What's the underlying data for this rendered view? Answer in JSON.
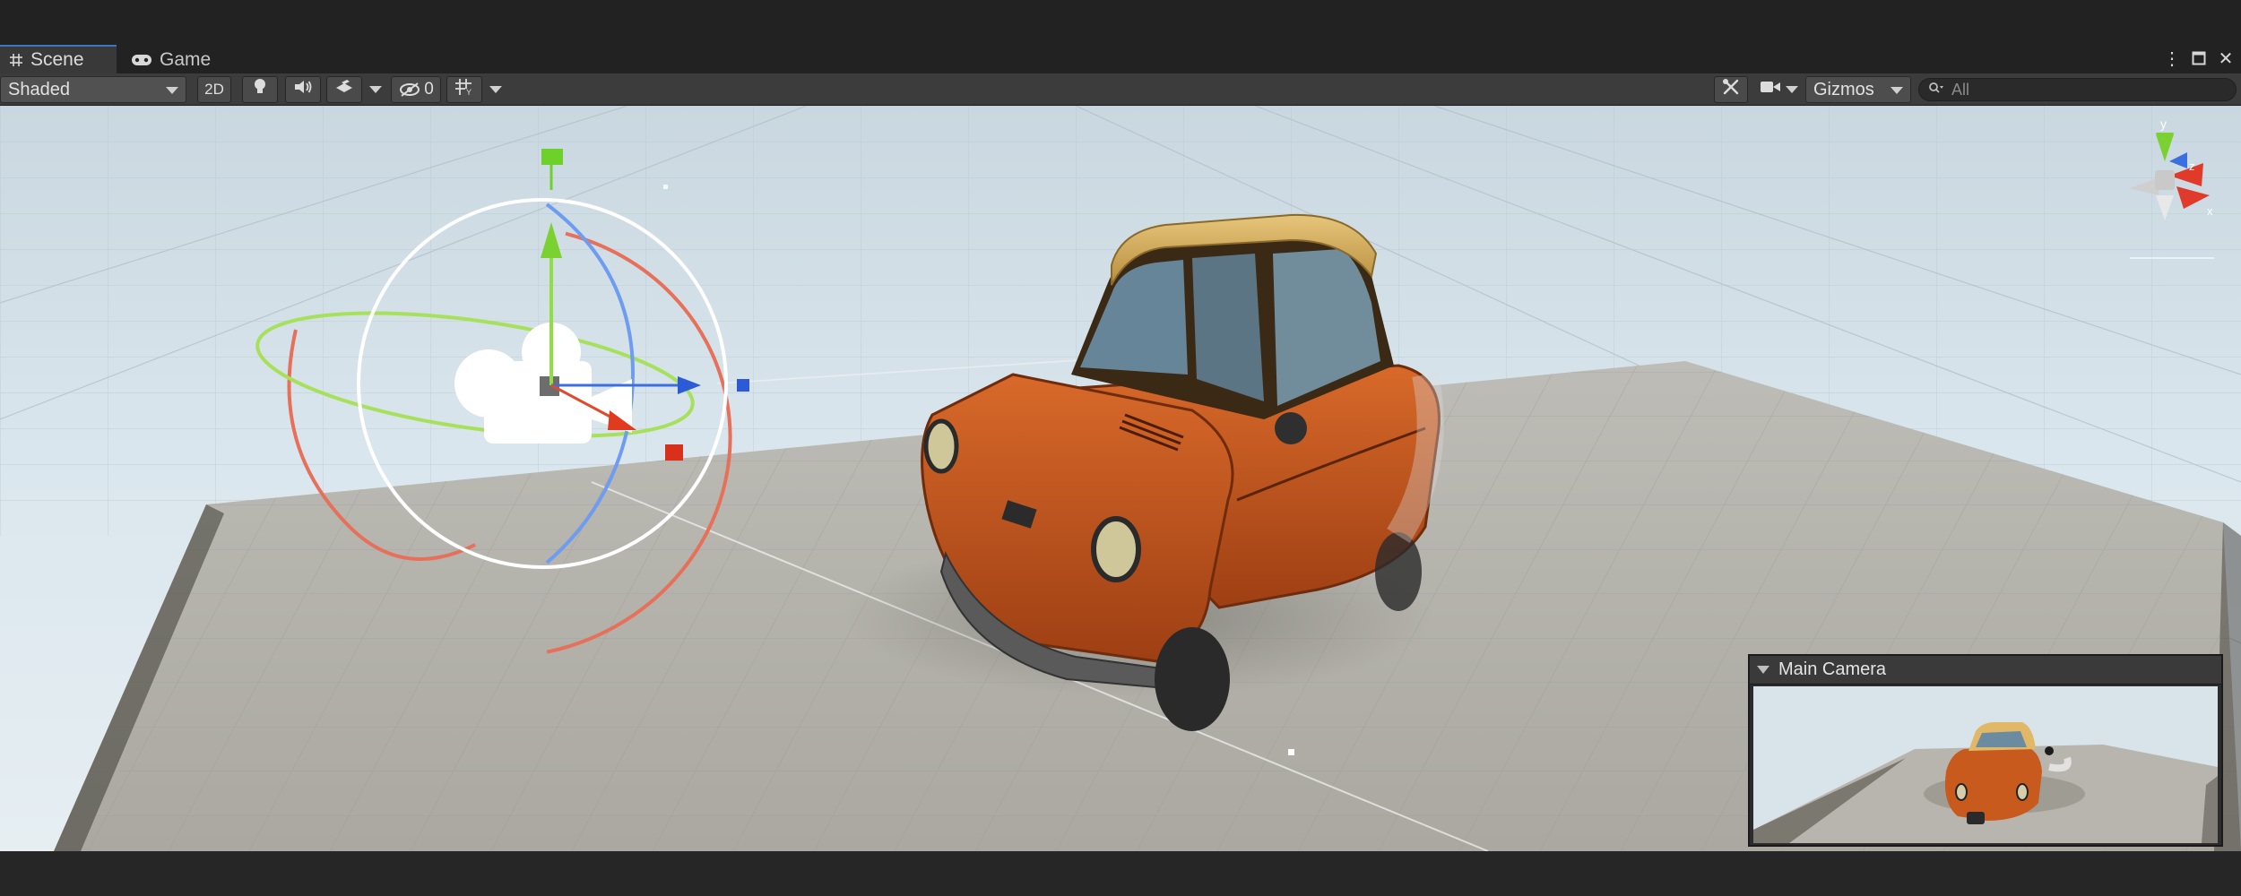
{
  "tabs": [
    {
      "label": "Scene",
      "icon": "grid-icon",
      "active": true
    },
    {
      "label": "Game",
      "icon": "gamepad-icon",
      "active": false
    }
  ],
  "window_controls": [
    "more-options-icon",
    "maximize-icon",
    "close-icon"
  ],
  "toolbar": {
    "shading_mode": "Shaded",
    "mode_2d_label": "2D",
    "hidden_count": "0",
    "gizmos_label": "Gizmos",
    "search_placeholder": "All"
  },
  "orientation_gizmo": {
    "y_label": "y",
    "x_label": "x",
    "z_label": "z"
  },
  "camera_preview": {
    "title": "Main Camera"
  },
  "colors": {
    "accent_tab": "#3a79bb",
    "axis_x": "#e03a2b",
    "axis_y": "#7dd23b",
    "axis_z": "#3a6fe0",
    "car_body": "#c8581c",
    "car_roof": "#d9b56a"
  }
}
